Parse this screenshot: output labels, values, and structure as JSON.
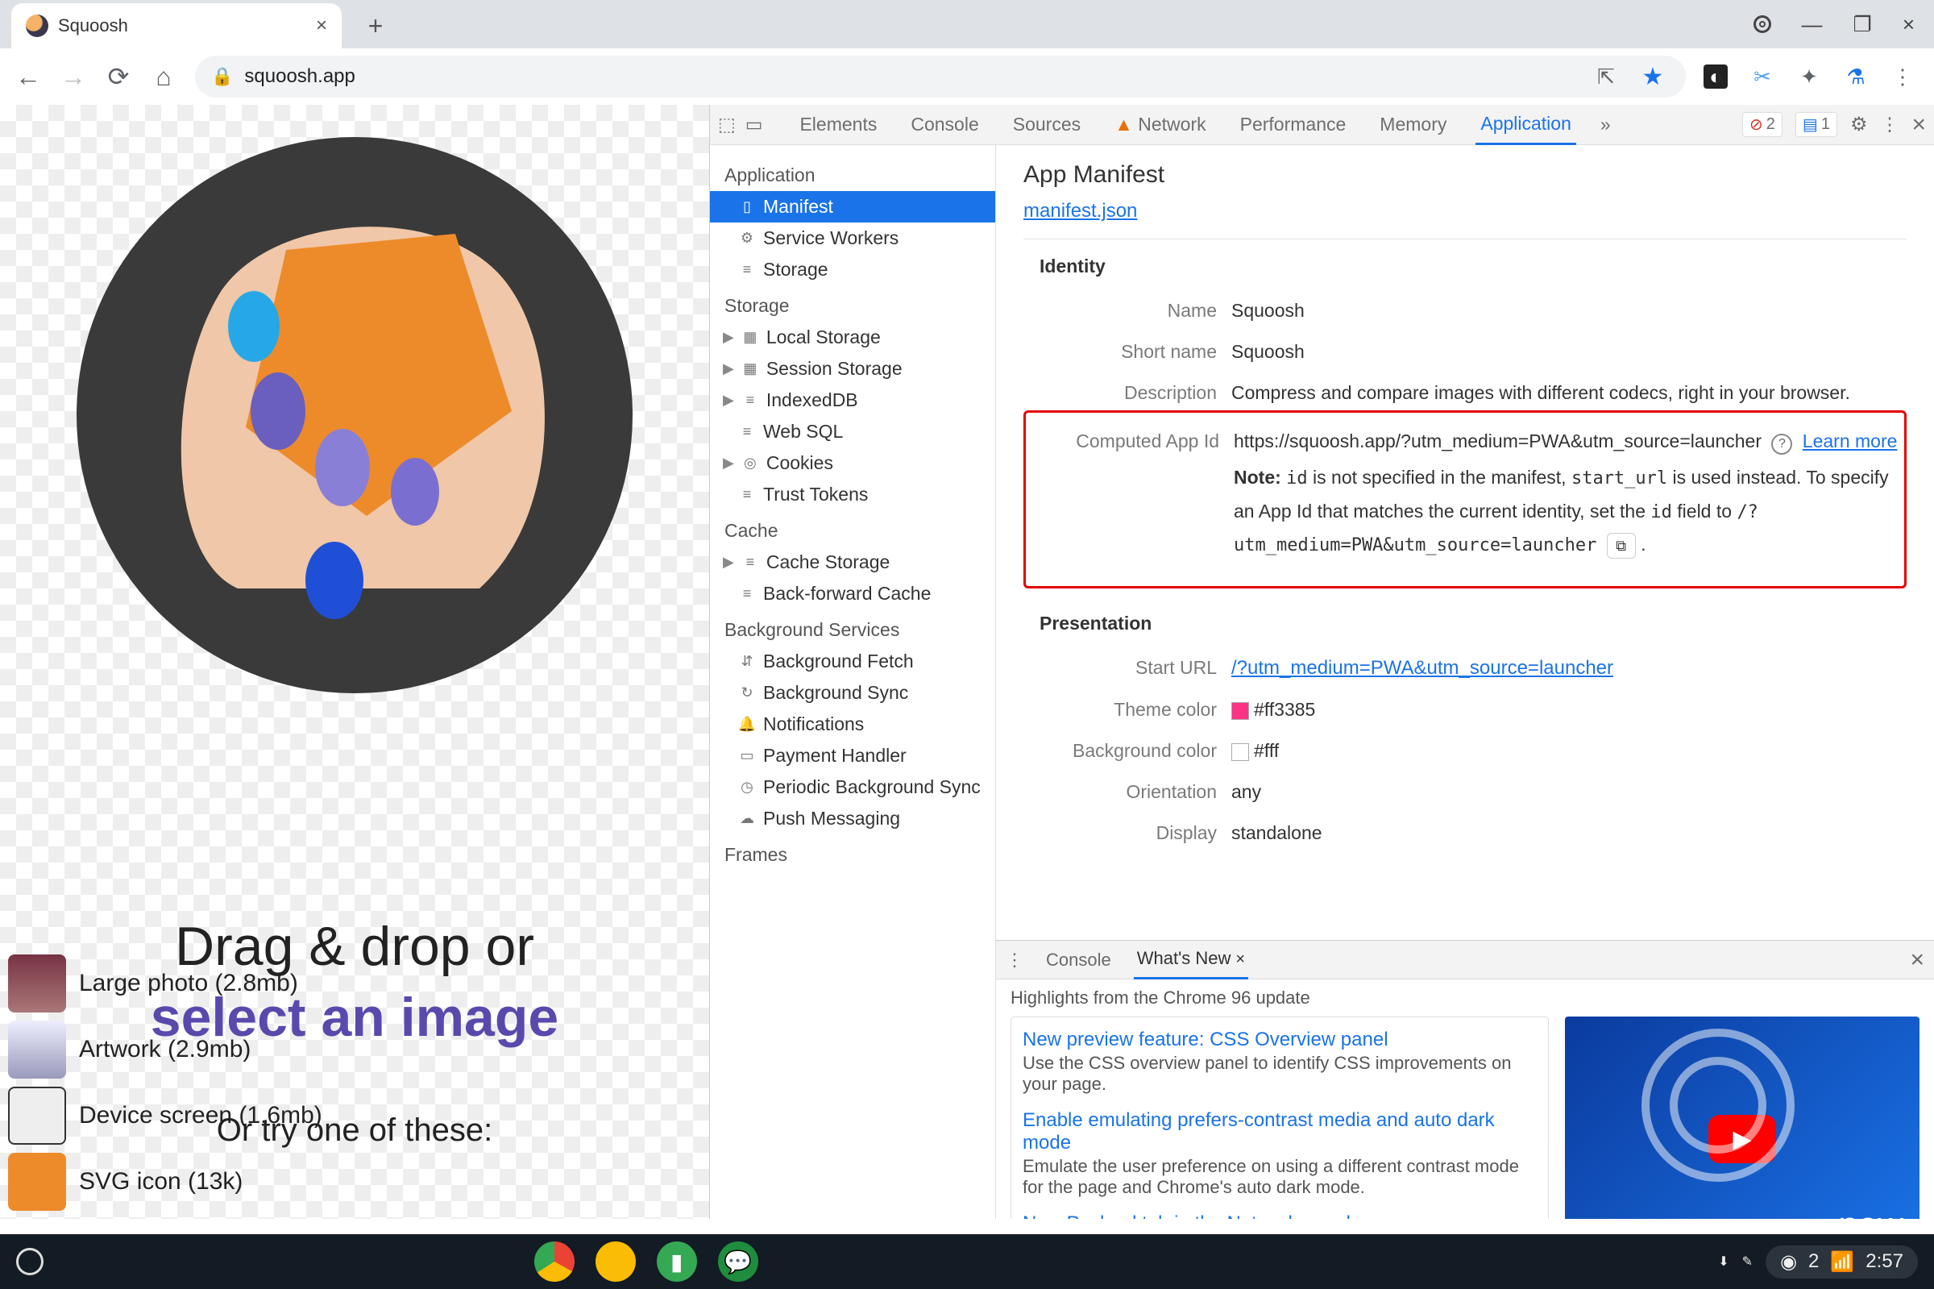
{
  "browser": {
    "tab_title": "Squoosh",
    "url": "squoosh.app"
  },
  "page": {
    "drag_line1": "Drag & drop or",
    "drag_line2": "select an image",
    "or_try": "Or try one of these:",
    "samples": [
      {
        "label": "Large photo (2.8mb)"
      },
      {
        "label": "Artwork (2.9mb)"
      },
      {
        "label": "Device screen (1.6mb)"
      },
      {
        "label": "SVG icon (13k)"
      }
    ]
  },
  "devtools": {
    "tabs": [
      "Elements",
      "Console",
      "Sources",
      "Network",
      "Performance",
      "Memory",
      "Application"
    ],
    "active_tab": "Application",
    "error_count": "2",
    "issue_count": "1",
    "sidebar": {
      "application": {
        "title": "Application",
        "items": [
          "Manifest",
          "Service Workers",
          "Storage"
        ],
        "selected": "Manifest"
      },
      "storage": {
        "title": "Storage",
        "items": [
          "Local Storage",
          "Session Storage",
          "IndexedDB",
          "Web SQL",
          "Cookies",
          "Trust Tokens"
        ]
      },
      "cache": {
        "title": "Cache",
        "items": [
          "Cache Storage",
          "Back-forward Cache"
        ]
      },
      "bg": {
        "title": "Background Services",
        "items": [
          "Background Fetch",
          "Background Sync",
          "Notifications",
          "Payment Handler",
          "Periodic Background Sync",
          "Push Messaging"
        ]
      },
      "frames": {
        "title": "Frames"
      }
    },
    "manifest": {
      "heading": "App Manifest",
      "json_link": "manifest.json",
      "identity_title": "Identity",
      "name_k": "Name",
      "name_v": "Squoosh",
      "short_k": "Short name",
      "short_v": "Squoosh",
      "desc_k": "Description",
      "desc_v": "Compress and compare images with different codecs, right in your browser.",
      "compid_k": "Computed App Id",
      "compid_v": "https://squoosh.app/?utm_medium=PWA&utm_source=launcher",
      "learn_more": "Learn more",
      "note_prefix": "Note:",
      "note_1": " is not specified in the manifest, ",
      "note_code_id": "id",
      "note_code_start": "start_url",
      "note_2": " is used instead. To specify an App Id that matches the current identity, set the ",
      "note_3": " field to ",
      "note_suggest": "/?utm_medium=PWA&utm_source=launcher",
      "presentation_title": "Presentation",
      "starturl_k": "Start URL",
      "starturl_v": "/?utm_medium=PWA&utm_source=launcher",
      "theme_k": "Theme color",
      "theme_v": "#ff3385",
      "bg_k": "Background color",
      "bg_v": "#fff",
      "orient_k": "Orientation",
      "orient_v": "any",
      "display_k": "Display",
      "display_v": "standalone"
    },
    "drawer": {
      "tabs": [
        {
          "label": "Console"
        },
        {
          "label": "What's New",
          "active": true,
          "closable": true
        }
      ],
      "subtitle": "Highlights from the Chrome 96 update",
      "news": [
        {
          "title": "New preview feature: CSS Overview panel",
          "desc": "Use the CSS overview panel to identify CSS improvements on your page."
        },
        {
          "title": "Enable emulating prefers-contrast media and auto dark mode",
          "desc": "Emulate the user preference on using a different contrast mode for the page and Chrome's auto dark mode."
        },
        {
          "title": "New Payload tab in the Network panel",
          "desc": ""
        }
      ],
      "thumb_label": "new"
    }
  },
  "taskbar": {
    "info_count": "2",
    "time": "2:57"
  }
}
